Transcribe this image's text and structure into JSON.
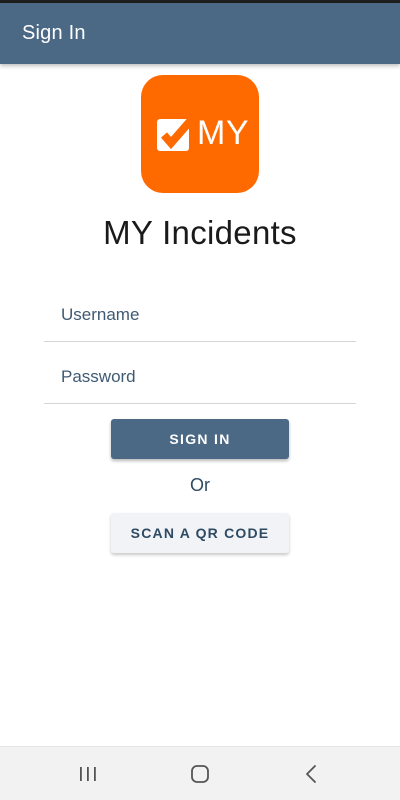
{
  "app_bar": {
    "title": "Sign In"
  },
  "logo": {
    "icon": "checkbox-icon",
    "text": "MY",
    "background_color": "#ff6a00"
  },
  "app_name": "MY Incidents",
  "form": {
    "username": {
      "value": "",
      "placeholder": "Username"
    },
    "password": {
      "value": "",
      "placeholder": "Password"
    },
    "sign_in_label": "SIGN IN",
    "or_label": "Or",
    "scan_qr_label": "SCAN A QR CODE"
  },
  "nav_bar": {
    "recents_icon": "recents-icon",
    "home_icon": "home-icon",
    "back_icon": "back-icon"
  },
  "colors": {
    "primary": "#4b6884",
    "accent": "#ff6a00",
    "secondary_button": "#f1f3f6"
  }
}
